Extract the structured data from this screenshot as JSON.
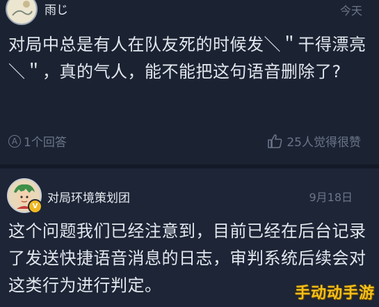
{
  "question": {
    "author": "雨じ",
    "time": "今天",
    "text": "对局中总是有人在队友死的时候发＼＂干得漂亮＼＂，真的气人，能不能把这句语音删除了?",
    "answers_label": "1个回答",
    "likes_label": "25人觉得很赞"
  },
  "answer": {
    "author": "对局环境策划团",
    "time": "9月18日",
    "badge": "V",
    "text": "这个问题我们已经注意到，目前已经在后台记录了发送快捷语音消息的日志，审判系统后续会对这类行为进行判定。"
  },
  "watermark": "手动动手游",
  "colors": {
    "background": "#1b2333",
    "text": "#e3e7ee",
    "muted": "#6b7588",
    "badge": "#f0b821"
  }
}
